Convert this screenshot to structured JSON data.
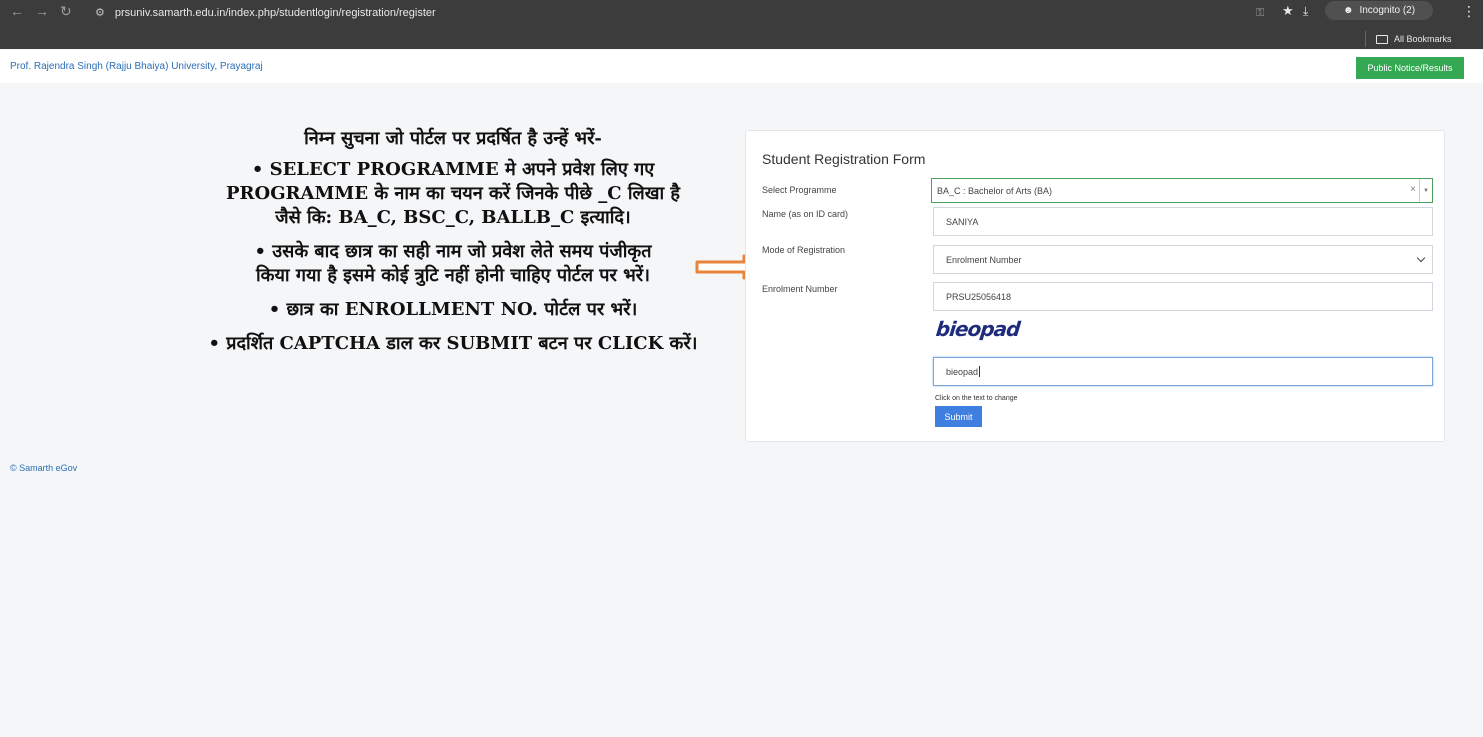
{
  "browser": {
    "url": "prsuniv.samarth.edu.in/index.php/studentlogin/registration/register",
    "incognito_label": "Incognito (2)",
    "bookmarks_label": "All Bookmarks"
  },
  "navbar": {
    "brand": "Prof. Rajendra Singh (Rajju Bhaiya) University, Prayagraj",
    "notice_button": "Public Notice/Results"
  },
  "instructions": {
    "title": "निम्न सुचना जो पोर्टल पर प्रदर्षित है उन्हें भरें-",
    "items": [
      [
        "• SELECT PROGRAMME मे अपने प्रवेश लिए गए",
        "PROGRAMME के नाम का चयन करें जिनके पीछे _C लिखा है",
        "जैसे कि: BA_C, BSC_C, BALLB_C इत्यादि।"
      ],
      [
        "• उसके बाद छात्र का सही नाम जो प्रवेश लेते समय पंजीकृत",
        "किया गया है इसमे कोई त्रुटि नहीं होनी चाहिए पोर्टल पर भरें।"
      ],
      [
        "• छात्र का ENROLLMENT NO. पोर्टल पर भरें।"
      ],
      [
        "• प्रदर्शित CAPTCHA डाल कर SUBMIT बटन पर CLICK करें।"
      ]
    ]
  },
  "form": {
    "title": "Student Registration Form",
    "programme_label": "Select Programme",
    "programme_value": "BA_C : Bachelor of Arts (BA)",
    "name_label": "Name (as on ID card)",
    "name_value": "SANIYA",
    "mode_label": "Mode of Registration",
    "mode_value": "Enrolment Number",
    "enrolment_label": "Enrolment Number",
    "enrolment_value": "PRSU25056418",
    "captcha_text": "bieopad",
    "captcha_input_value": "bieopad",
    "captcha_hint": "Click on the text to change",
    "submit_label": "Submit"
  },
  "footer": {
    "copyright": "© Samarth eGov"
  },
  "colors": {
    "accent_green": "#35a853",
    "link_blue": "#2c6fb7",
    "submit_blue": "#3f7fe0",
    "arrow_orange": "#e8833a"
  }
}
